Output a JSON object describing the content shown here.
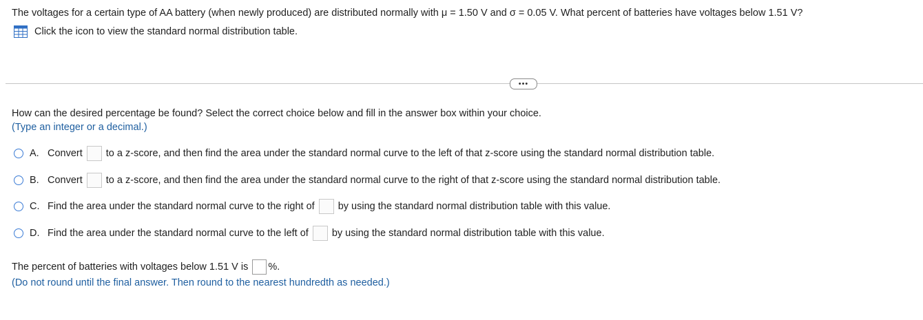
{
  "question": {
    "text": "The voltages for a certain type of AA battery (when newly produced) are distributed normally with μ = 1.50 V and σ = 0.05 V. What percent of batteries have voltages below 1.51 V?"
  },
  "table_link": {
    "text": "Click the icon to view the standard normal distribution table.",
    "icon": "table-icon"
  },
  "more_button": {
    "label": "•••"
  },
  "prompt": {
    "text": "How can the desired percentage be found? Select the correct choice below and fill in the answer box within your choice.",
    "hint": "(Type an integer or a decimal.)"
  },
  "choices": [
    {
      "letter": "A.",
      "before": "Convert",
      "after": "to a z-score, and then find the area under the standard normal curve to the left of that z-score using the standard normal distribution table.",
      "value": ""
    },
    {
      "letter": "B.",
      "before": "Convert",
      "after": "to a z-score, and then find the area under the standard normal curve to the right of that z-score using the standard normal distribution table.",
      "value": ""
    },
    {
      "letter": "C.",
      "before": "Find the area under the standard normal curve to the right of",
      "after": "by using the standard normal distribution table with this value.",
      "value": ""
    },
    {
      "letter": "D.",
      "before": "Find the area under the standard normal curve to the left of",
      "after": "by using the standard normal distribution table with this value.",
      "value": ""
    }
  ],
  "final": {
    "before": "The percent of batteries with voltages below 1.51 V is",
    "after": "%.",
    "value": "",
    "hint": "(Do not round until the final answer. Then round to the nearest hundredth as needed.)"
  },
  "colors": {
    "hint_blue": "#1f5fa0",
    "radio_blue": "#3a7bd5",
    "icon_blue": "#2f6fc4"
  }
}
